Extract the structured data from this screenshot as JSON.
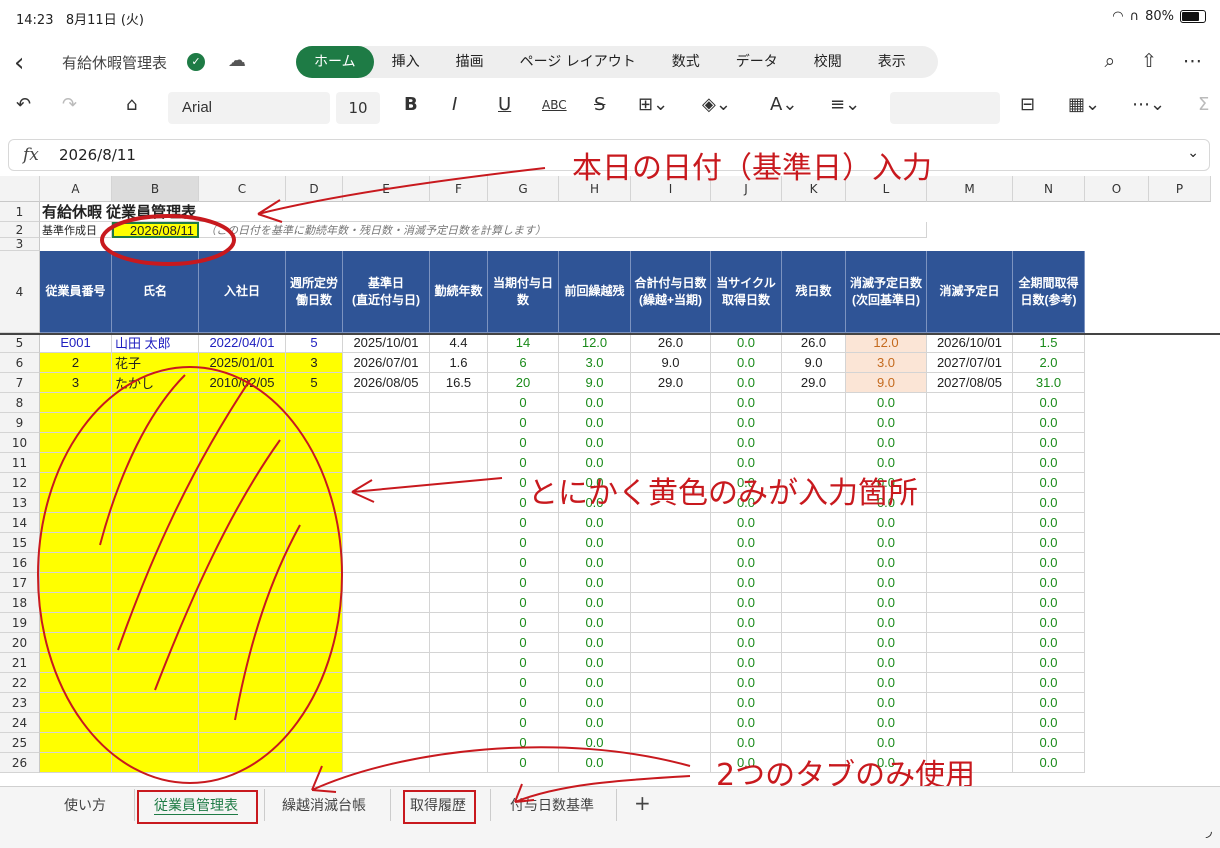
{
  "status": {
    "time": "14:23",
    "date": "8月11日 (火)",
    "battery": "80%"
  },
  "titlebar": {
    "document_title": "有給休暇管理表",
    "tabs": [
      "ホーム",
      "挿入",
      "描画",
      "ページ レイアウト",
      "数式",
      "データ",
      "校閲",
      "表示"
    ]
  },
  "toolbar": {
    "font": "Arial",
    "size": "10"
  },
  "formula_bar": {
    "fx": "fx",
    "value": "2026/8/11"
  },
  "columns": [
    "A",
    "B",
    "C",
    "D",
    "E",
    "F",
    "G",
    "H",
    "I",
    "J",
    "K",
    "L",
    "M",
    "N",
    "O",
    "P"
  ],
  "sheet": {
    "title": "有給休暇 従業員管理表",
    "base_label": "基準作成日",
    "base_date": "2026/08/11",
    "note": "（この日付を基準に勤続年数・残日数・消滅予定日数を計算します）",
    "headers": [
      "従業員番号",
      "氏名",
      "入社日",
      "週所定労働日数",
      "基準日\n(直近付与日)",
      "勤続年数",
      "当期付与日数",
      "前回繰越残",
      "合計付与日数\n(繰越+当期)",
      "当サイクル取得日数",
      "残日数",
      "消滅予定日数\n(次回基準日)",
      "消滅予定日",
      "全期間取得日数(参考)"
    ],
    "rows": [
      [
        "E001",
        "山田 太郎",
        "2022/04/01",
        "5",
        "2025/10/01",
        "4.4",
        "14",
        "12.0",
        "26.0",
        "0.0",
        "26.0",
        "12.0",
        "2026/10/01",
        "1.5"
      ],
      [
        "2",
        "花子",
        "2025/01/01",
        "3",
        "2026/07/01",
        "1.6",
        "6",
        "3.0",
        "9.0",
        "0.0",
        "9.0",
        "3.0",
        "2027/07/01",
        "2.0"
      ],
      [
        "3",
        "たかし",
        "2010/02/05",
        "5",
        "2026/08/05",
        "16.5",
        "20",
        "9.0",
        "29.0",
        "0.0",
        "29.0",
        "9.0",
        "2027/08/05",
        "31.0"
      ]
    ],
    "empty_values": {
      "g": "0",
      "h": "0.0",
      "j": "0.0",
      "l": "0.0",
      "n": "0.0"
    }
  },
  "sheet_tabs": [
    "使い方",
    "従業員管理表",
    "繰越消滅台帳",
    "取得履歴",
    "付与日数基準",
    "+"
  ],
  "annotations": {
    "top": "本日の日付（基準日）入力",
    "middle": "とにかく黄色のみが入力箇所",
    "bottom": "2つのタブのみ使用"
  },
  "colors": {
    "accent": "#1e7b45",
    "header": "#2f5496",
    "input": "#ffff00",
    "annotation": "#c8191e"
  }
}
